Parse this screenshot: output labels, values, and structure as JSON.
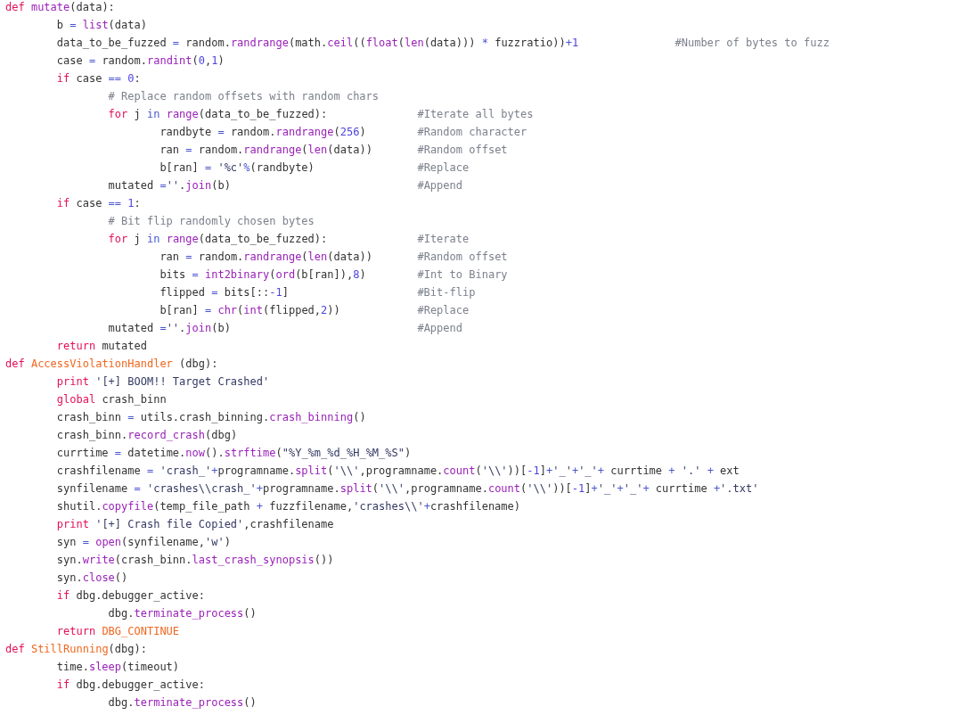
{
  "code_lines": [
    {
      "tokens": [
        {
          "text": "def ",
          "kind": "keyword"
        },
        {
          "text": "mutate",
          "kind": "builtin"
        },
        {
          "text": "(data):",
          "kind": "plain"
        }
      ]
    },
    {
      "tokens": [
        {
          "text": "        b ",
          "kind": "plain"
        },
        {
          "text": "= ",
          "kind": "operator"
        },
        {
          "text": "list",
          "kind": "builtin"
        },
        {
          "text": "(data)",
          "kind": "plain"
        }
      ]
    },
    {
      "tokens": [
        {
          "text": "        data_to_be_fuzzed ",
          "kind": "plain"
        },
        {
          "text": "=",
          "kind": "operator"
        },
        {
          "text": " random.",
          "kind": "plain"
        },
        {
          "text": "randrange",
          "kind": "builtin"
        },
        {
          "text": "(math.",
          "kind": "plain"
        },
        {
          "text": "ceil",
          "kind": "builtin"
        },
        {
          "text": "((",
          "kind": "plain"
        },
        {
          "text": "float",
          "kind": "builtin"
        },
        {
          "text": "(",
          "kind": "plain"
        },
        {
          "text": "len",
          "kind": "builtin"
        },
        {
          "text": "(data))) ",
          "kind": "plain"
        },
        {
          "text": "*",
          "kind": "operator"
        },
        {
          "text": " fuzzratio))",
          "kind": "plain"
        },
        {
          "text": "+",
          "kind": "operator"
        },
        {
          "text": "1",
          "kind": "number"
        },
        {
          "text": "               #Number of bytes to fuzz",
          "kind": "comment"
        }
      ]
    },
    {
      "tokens": [
        {
          "text": "        case ",
          "kind": "plain"
        },
        {
          "text": "=",
          "kind": "operator"
        },
        {
          "text": " random.",
          "kind": "plain"
        },
        {
          "text": "randint",
          "kind": "builtin"
        },
        {
          "text": "(",
          "kind": "plain"
        },
        {
          "text": "0",
          "kind": "number"
        },
        {
          "text": ",",
          "kind": "plain"
        },
        {
          "text": "1",
          "kind": "number"
        },
        {
          "text": ")",
          "kind": "plain"
        }
      ]
    },
    {
      "tokens": [
        {
          "text": "        if",
          "kind": "keyword"
        },
        {
          "text": " case ",
          "kind": "plain"
        },
        {
          "text": "== ",
          "kind": "operator"
        },
        {
          "text": "0",
          "kind": "number"
        },
        {
          "text": ":",
          "kind": "plain"
        }
      ]
    },
    {
      "tokens": [
        {
          "text": "                # Replace random offsets with random chars",
          "kind": "comment"
        }
      ]
    },
    {
      "tokens": [
        {
          "text": "                for",
          "kind": "keyword"
        },
        {
          "text": " j ",
          "kind": "plain"
        },
        {
          "text": "in ",
          "kind": "operator"
        },
        {
          "text": "range",
          "kind": "builtin"
        },
        {
          "text": "(data_to_be_fuzzed):",
          "kind": "plain"
        },
        {
          "text": "              #Iterate all bytes",
          "kind": "comment"
        }
      ]
    },
    {
      "tokens": [
        {
          "text": "                        randbyte ",
          "kind": "plain"
        },
        {
          "text": "=",
          "kind": "operator"
        },
        {
          "text": " random.",
          "kind": "plain"
        },
        {
          "text": "randrange",
          "kind": "builtin"
        },
        {
          "text": "(",
          "kind": "plain"
        },
        {
          "text": "256",
          "kind": "number"
        },
        {
          "text": ")",
          "kind": "plain"
        },
        {
          "text": "        #Random character",
          "kind": "comment"
        }
      ]
    },
    {
      "tokens": [
        {
          "text": "                        ran ",
          "kind": "plain"
        },
        {
          "text": "=",
          "kind": "operator"
        },
        {
          "text": " random.",
          "kind": "plain"
        },
        {
          "text": "randrange",
          "kind": "builtin"
        },
        {
          "text": "(",
          "kind": "plain"
        },
        {
          "text": "len",
          "kind": "builtin"
        },
        {
          "text": "(data))",
          "kind": "plain"
        },
        {
          "text": "       #Random offset",
          "kind": "comment"
        }
      ]
    },
    {
      "tokens": [
        {
          "text": "                        b[ran] ",
          "kind": "plain"
        },
        {
          "text": "= ",
          "kind": "operator"
        },
        {
          "text": "'%c'",
          "kind": "string"
        },
        {
          "text": "%",
          "kind": "operator"
        },
        {
          "text": "(randbyte)",
          "kind": "plain"
        },
        {
          "text": "                #Replace",
          "kind": "comment"
        }
      ]
    },
    {
      "tokens": [
        {
          "text": "                mutated ",
          "kind": "plain"
        },
        {
          "text": "=",
          "kind": "operator"
        },
        {
          "text": "''",
          "kind": "string"
        },
        {
          "text": ".",
          "kind": "plain"
        },
        {
          "text": "join",
          "kind": "builtin"
        },
        {
          "text": "(b)",
          "kind": "plain"
        },
        {
          "text": "                             #Append",
          "kind": "comment"
        }
      ]
    },
    {
      "tokens": [
        {
          "text": "        if",
          "kind": "keyword"
        },
        {
          "text": " case ",
          "kind": "plain"
        },
        {
          "text": "== ",
          "kind": "operator"
        },
        {
          "text": "1",
          "kind": "number"
        },
        {
          "text": ":",
          "kind": "plain"
        }
      ]
    },
    {
      "tokens": [
        {
          "text": "                # Bit flip randomly chosen bytes",
          "kind": "comment"
        }
      ]
    },
    {
      "tokens": [
        {
          "text": "                for",
          "kind": "keyword"
        },
        {
          "text": " j ",
          "kind": "plain"
        },
        {
          "text": "in ",
          "kind": "operator"
        },
        {
          "text": "range",
          "kind": "builtin"
        },
        {
          "text": "(data_to_be_fuzzed):",
          "kind": "plain"
        },
        {
          "text": "              #Iterate",
          "kind": "comment"
        }
      ]
    },
    {
      "tokens": [
        {
          "text": "                        ran ",
          "kind": "plain"
        },
        {
          "text": "=",
          "kind": "operator"
        },
        {
          "text": " random.",
          "kind": "plain"
        },
        {
          "text": "randrange",
          "kind": "builtin"
        },
        {
          "text": "(",
          "kind": "plain"
        },
        {
          "text": "len",
          "kind": "builtin"
        },
        {
          "text": "(data))",
          "kind": "plain"
        },
        {
          "text": "       #Random offset",
          "kind": "comment"
        }
      ]
    },
    {
      "tokens": [
        {
          "text": "                        bits ",
          "kind": "plain"
        },
        {
          "text": "= ",
          "kind": "operator"
        },
        {
          "text": "int2binary",
          "kind": "builtin"
        },
        {
          "text": "(",
          "kind": "plain"
        },
        {
          "text": "ord",
          "kind": "builtin"
        },
        {
          "text": "(b[ran]),",
          "kind": "plain"
        },
        {
          "text": "8",
          "kind": "number"
        },
        {
          "text": ")",
          "kind": "plain"
        },
        {
          "text": "        #Int to Binary",
          "kind": "comment"
        }
      ]
    },
    {
      "tokens": [
        {
          "text": "                        flipped ",
          "kind": "plain"
        },
        {
          "text": "=",
          "kind": "operator"
        },
        {
          "text": " bits[::",
          "kind": "plain"
        },
        {
          "text": "-1",
          "kind": "number"
        },
        {
          "text": "]",
          "kind": "plain"
        },
        {
          "text": "                    #Bit-flip",
          "kind": "comment"
        }
      ]
    },
    {
      "tokens": [
        {
          "text": "                        b[ran] ",
          "kind": "plain"
        },
        {
          "text": "= ",
          "kind": "operator"
        },
        {
          "text": "chr",
          "kind": "builtin"
        },
        {
          "text": "(",
          "kind": "plain"
        },
        {
          "text": "int",
          "kind": "builtin"
        },
        {
          "text": "(flipped,",
          "kind": "plain"
        },
        {
          "text": "2",
          "kind": "number"
        },
        {
          "text": "))",
          "kind": "plain"
        },
        {
          "text": "            #Replace",
          "kind": "comment"
        }
      ]
    },
    {
      "tokens": [
        {
          "text": "                mutated ",
          "kind": "plain"
        },
        {
          "text": "=",
          "kind": "operator"
        },
        {
          "text": "''",
          "kind": "string"
        },
        {
          "text": ".",
          "kind": "plain"
        },
        {
          "text": "join",
          "kind": "builtin"
        },
        {
          "text": "(b)",
          "kind": "plain"
        },
        {
          "text": "                             #Append",
          "kind": "comment"
        }
      ]
    },
    {
      "tokens": [
        {
          "text": "        return",
          "kind": "keyword"
        },
        {
          "text": " mutated",
          "kind": "plain"
        }
      ]
    },
    {
      "tokens": [
        {
          "text": "def ",
          "kind": "keyword"
        },
        {
          "text": "AccessViolationHandler",
          "kind": "function"
        },
        {
          "text": " (dbg):",
          "kind": "plain"
        }
      ]
    },
    {
      "tokens": [
        {
          "text": "        print ",
          "kind": "keyword"
        },
        {
          "text": "'[+] BOOM!! Target Crashed'",
          "kind": "string"
        }
      ]
    },
    {
      "tokens": [
        {
          "text": "        global",
          "kind": "keyword"
        },
        {
          "text": " crash_binn",
          "kind": "plain"
        }
      ]
    },
    {
      "tokens": [
        {
          "text": "        crash_binn ",
          "kind": "plain"
        },
        {
          "text": "=",
          "kind": "operator"
        },
        {
          "text": " utils.crash_binning.",
          "kind": "plain"
        },
        {
          "text": "crash_binning",
          "kind": "builtin"
        },
        {
          "text": "()",
          "kind": "plain"
        }
      ]
    },
    {
      "tokens": [
        {
          "text": "        crash_binn.",
          "kind": "plain"
        },
        {
          "text": "record_crash",
          "kind": "builtin"
        },
        {
          "text": "(dbg)",
          "kind": "plain"
        }
      ]
    },
    {
      "tokens": [
        {
          "text": "        currtime ",
          "kind": "plain"
        },
        {
          "text": "=",
          "kind": "operator"
        },
        {
          "text": " datetime.",
          "kind": "plain"
        },
        {
          "text": "now",
          "kind": "builtin"
        },
        {
          "text": "().",
          "kind": "plain"
        },
        {
          "text": "strftime",
          "kind": "builtin"
        },
        {
          "text": "(",
          "kind": "plain"
        },
        {
          "text": "\"%Y_%m_%d_%H_%M_%S\"",
          "kind": "string"
        },
        {
          "text": ")",
          "kind": "plain"
        }
      ]
    },
    {
      "tokens": [
        {
          "text": "        crashfilename ",
          "kind": "plain"
        },
        {
          "text": "= ",
          "kind": "operator"
        },
        {
          "text": "'crash_'",
          "kind": "string"
        },
        {
          "text": "+",
          "kind": "operator"
        },
        {
          "text": "programname.",
          "kind": "plain"
        },
        {
          "text": "split",
          "kind": "builtin"
        },
        {
          "text": "(",
          "kind": "plain"
        },
        {
          "text": "'\\\\'",
          "kind": "string"
        },
        {
          "text": ",programname.",
          "kind": "plain"
        },
        {
          "text": "count",
          "kind": "builtin"
        },
        {
          "text": "(",
          "kind": "plain"
        },
        {
          "text": "'\\\\'",
          "kind": "string"
        },
        {
          "text": "))[",
          "kind": "plain"
        },
        {
          "text": "-1",
          "kind": "number"
        },
        {
          "text": "]",
          "kind": "plain"
        },
        {
          "text": "+",
          "kind": "operator"
        },
        {
          "text": "'_'",
          "kind": "string"
        },
        {
          "text": "+",
          "kind": "operator"
        },
        {
          "text": "'_'",
          "kind": "string"
        },
        {
          "text": "+",
          "kind": "operator"
        },
        {
          "text": " currtime ",
          "kind": "plain"
        },
        {
          "text": "+ ",
          "kind": "operator"
        },
        {
          "text": "'.' ",
          "kind": "string"
        },
        {
          "text": "+",
          "kind": "operator"
        },
        {
          "text": " ext",
          "kind": "plain"
        }
      ]
    },
    {
      "tokens": [
        {
          "text": "        synfilename ",
          "kind": "plain"
        },
        {
          "text": "= ",
          "kind": "operator"
        },
        {
          "text": "'crashes\\\\crash_'",
          "kind": "string"
        },
        {
          "text": "+",
          "kind": "operator"
        },
        {
          "text": "programname.",
          "kind": "plain"
        },
        {
          "text": "split",
          "kind": "builtin"
        },
        {
          "text": "(",
          "kind": "plain"
        },
        {
          "text": "'\\\\'",
          "kind": "string"
        },
        {
          "text": ",programname.",
          "kind": "plain"
        },
        {
          "text": "count",
          "kind": "builtin"
        },
        {
          "text": "(",
          "kind": "plain"
        },
        {
          "text": "'\\\\'",
          "kind": "string"
        },
        {
          "text": "))[",
          "kind": "plain"
        },
        {
          "text": "-1",
          "kind": "number"
        },
        {
          "text": "]",
          "kind": "plain"
        },
        {
          "text": "+",
          "kind": "operator"
        },
        {
          "text": "'_'",
          "kind": "string"
        },
        {
          "text": "+",
          "kind": "operator"
        },
        {
          "text": "'_'",
          "kind": "string"
        },
        {
          "text": "+",
          "kind": "operator"
        },
        {
          "text": " currtime ",
          "kind": "plain"
        },
        {
          "text": "+",
          "kind": "operator"
        },
        {
          "text": "'.txt'",
          "kind": "string"
        }
      ]
    },
    {
      "tokens": [
        {
          "text": "        shutil.",
          "kind": "plain"
        },
        {
          "text": "copyfile",
          "kind": "builtin"
        },
        {
          "text": "(temp_file_path ",
          "kind": "plain"
        },
        {
          "text": "+",
          "kind": "operator"
        },
        {
          "text": " fuzzfilename,",
          "kind": "plain"
        },
        {
          "text": "'crashes\\\\'",
          "kind": "string"
        },
        {
          "text": "+",
          "kind": "operator"
        },
        {
          "text": "crashfilename)",
          "kind": "plain"
        }
      ]
    },
    {
      "tokens": [
        {
          "text": "        print ",
          "kind": "keyword"
        },
        {
          "text": "'[+] Crash file Copied'",
          "kind": "string"
        },
        {
          "text": ",crashfilename",
          "kind": "plain"
        }
      ]
    },
    {
      "tokens": [
        {
          "text": "        syn ",
          "kind": "plain"
        },
        {
          "text": "= ",
          "kind": "operator"
        },
        {
          "text": "open",
          "kind": "builtin"
        },
        {
          "text": "(synfilename,",
          "kind": "plain"
        },
        {
          "text": "'w'",
          "kind": "string"
        },
        {
          "text": ")",
          "kind": "plain"
        }
      ]
    },
    {
      "tokens": [
        {
          "text": "        syn.",
          "kind": "plain"
        },
        {
          "text": "write",
          "kind": "builtin"
        },
        {
          "text": "(crash_binn.",
          "kind": "plain"
        },
        {
          "text": "last_crash_synopsis",
          "kind": "builtin"
        },
        {
          "text": "())",
          "kind": "plain"
        }
      ]
    },
    {
      "tokens": [
        {
          "text": "        syn.",
          "kind": "plain"
        },
        {
          "text": "close",
          "kind": "builtin"
        },
        {
          "text": "()",
          "kind": "plain"
        }
      ]
    },
    {
      "tokens": [
        {
          "text": "        if",
          "kind": "keyword"
        },
        {
          "text": " dbg.debugger_active:",
          "kind": "plain"
        }
      ]
    },
    {
      "tokens": [
        {
          "text": "                dbg.",
          "kind": "plain"
        },
        {
          "text": "terminate_process",
          "kind": "builtin"
        },
        {
          "text": "()",
          "kind": "plain"
        }
      ]
    },
    {
      "tokens": [
        {
          "text": "        return ",
          "kind": "keyword"
        },
        {
          "text": "DBG_CONTINUE",
          "kind": "constant"
        }
      ]
    },
    {
      "tokens": [
        {
          "text": "def ",
          "kind": "keyword"
        },
        {
          "text": "StillRunning",
          "kind": "function"
        },
        {
          "text": "(dbg):",
          "kind": "plain"
        }
      ]
    },
    {
      "tokens": [
        {
          "text": "        time.",
          "kind": "plain"
        },
        {
          "text": "sleep",
          "kind": "builtin"
        },
        {
          "text": "(timeout)",
          "kind": "plain"
        }
      ]
    },
    {
      "tokens": [
        {
          "text": "        if",
          "kind": "keyword"
        },
        {
          "text": " dbg.debugger_active:",
          "kind": "plain"
        }
      ]
    },
    {
      "tokens": [
        {
          "text": "                dbg.",
          "kind": "plain"
        },
        {
          "text": "terminate_process",
          "kind": "builtin"
        },
        {
          "text": "()",
          "kind": "plain"
        }
      ]
    }
  ]
}
